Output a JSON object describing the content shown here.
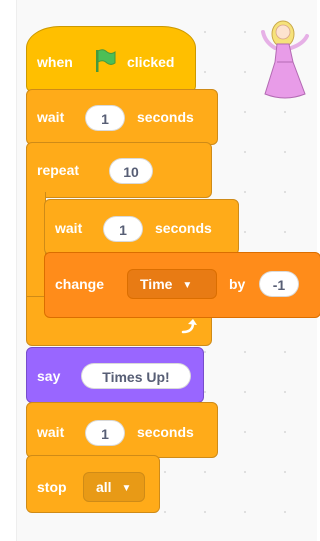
{
  "script": {
    "hat_when": "when",
    "hat_clicked": "clicked",
    "wait1": {
      "label": "wait",
      "value": "1",
      "unit": "seconds"
    },
    "repeat": {
      "label": "repeat",
      "value": "10"
    },
    "inner_wait": {
      "label": "wait",
      "value": "1",
      "unit": "seconds"
    },
    "change": {
      "label": "change",
      "variable": "Time",
      "by": "by",
      "value": "-1"
    },
    "say": {
      "label": "say",
      "message": "Times Up!"
    },
    "wait2": {
      "label": "wait",
      "value": "1",
      "unit": "seconds"
    },
    "stop": {
      "label": "stop",
      "option": "all"
    }
  },
  "icons": {
    "flag": "green-flag-icon",
    "loop_arrow": "repeat-arrow-icon",
    "sprite": "princess-sprite"
  },
  "colors": {
    "events": "#ffbf00",
    "control": "#ffab19",
    "variables": "#ff8c1a",
    "looks": "#9966ff",
    "flag_green": "#4cbf56"
  }
}
